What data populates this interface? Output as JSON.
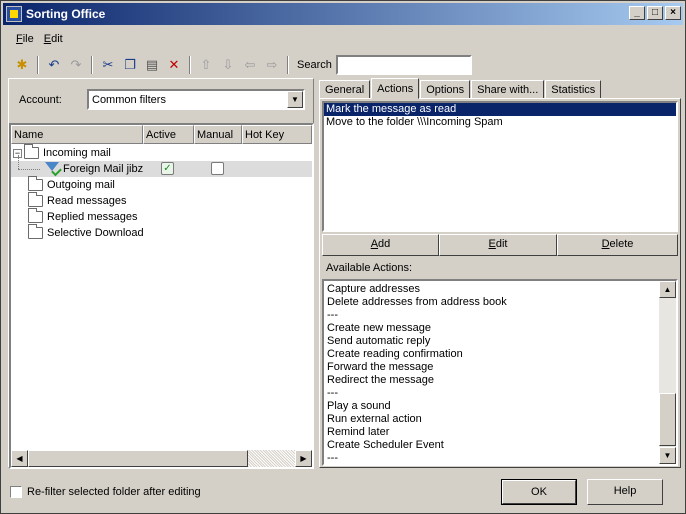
{
  "window": {
    "title": "Sorting Office"
  },
  "title_buttons": {
    "minimize": "_",
    "maximize": "□",
    "close": "×"
  },
  "menu": [
    {
      "label": "File",
      "key": "F"
    },
    {
      "label": "Edit",
      "key": "E"
    }
  ],
  "search": {
    "label": "Search",
    "value": ""
  },
  "account": {
    "label": "Account:",
    "selected": "Common filters"
  },
  "tree": {
    "columns": [
      "Name",
      "Active",
      "Manual",
      "Hot Key"
    ],
    "items": [
      {
        "label": "Incoming mail",
        "type": "folder",
        "expander": "−"
      },
      {
        "label": "Foreign Mail jibz",
        "type": "filter",
        "active": true,
        "manual": false
      },
      {
        "label": "Outgoing mail",
        "type": "folder"
      },
      {
        "label": "Read messages",
        "type": "folder"
      },
      {
        "label": "Replied messages",
        "type": "folder"
      },
      {
        "label": "Selective Download",
        "type": "folder"
      }
    ]
  },
  "tabs": [
    "General",
    "Actions",
    "Options",
    "Share with...",
    "Statistics"
  ],
  "active_tab": "Actions",
  "actions": [
    "Mark the message as read",
    "Move to the folder \\\\\\Incoming Spam"
  ],
  "buttons": {
    "add": "Add",
    "edit": "Edit",
    "delete": "Delete"
  },
  "available_label": "Available Actions:",
  "available_actions": [
    "Capture addresses",
    "Delete addresses from address book",
    "---",
    "Create new message",
    "Send automatic reply",
    "Create reading confirmation",
    "Forward the message",
    "Redirect the message",
    "---",
    "Play a sound",
    "Run external action",
    "Remind later",
    "Create Scheduler Event",
    "---"
  ],
  "refilter_label": "Re-filter selected folder after editing",
  "ok_label": "OK",
  "help_label": "Help",
  "colors": {
    "selection": "#0a246a",
    "titlebar_start": "#0a246a",
    "titlebar_end": "#a6caf0"
  }
}
